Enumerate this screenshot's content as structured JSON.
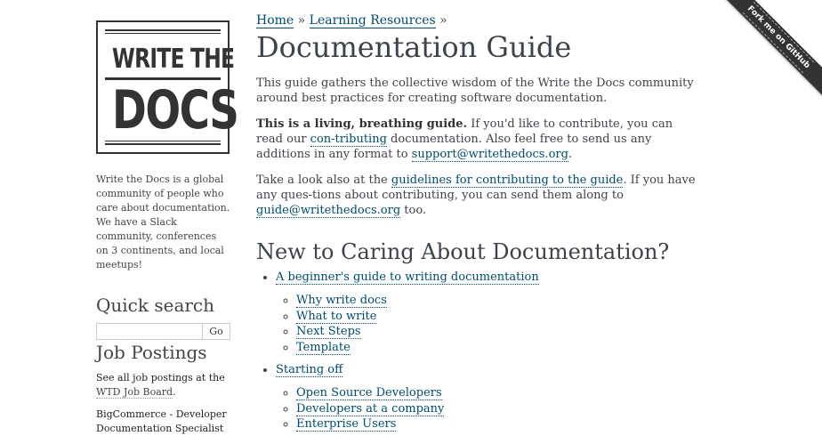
{
  "sidebar": {
    "logo": {
      "line1": "WRITE THE",
      "line2": "DOCS"
    },
    "about": "Write the Docs is a global community of people who care about documentation. We have a Slack community, conferences on 3 continents, and local meetups!",
    "quick_search": {
      "heading": "Quick search",
      "input_value": "",
      "button": "Go"
    },
    "job_postings": {
      "heading": "Job Postings",
      "see_all_prefix": "See all job postings at the ",
      "board_link": "WTD Job Board",
      "see_all_suffix": ".",
      "first_job": "BigCommerce - Developer Documentation Specialist"
    }
  },
  "main": {
    "breadcrumbs": [
      {
        "label": "Home"
      },
      {
        "label": "Learning Resources"
      }
    ],
    "title": "Documentation Guide",
    "intro": "This guide gathers the collective wisdom of the Write the Docs community around best practices for creating software documentation.",
    "living": {
      "bold": "This is a living, breathing guide.",
      "text1": " If you'd like to contribute, you can read our ",
      "link1": "con-tributing",
      "text2": " documentation. Also feel free to send us any additions in any format to ",
      "link2": "support@writethedocs.org",
      "text3": "."
    },
    "guidelines": {
      "text1": "Take a look also at the ",
      "link1": "guidelines for contributing to the guide",
      "text2": ". If you have any ques-tions about contributing, you can send them along to ",
      "link2": "guide@writethedocs.org",
      "text3": " too."
    },
    "section_heading": "New to Caring About Documentation?",
    "list": [
      {
        "label": "A beginner's guide to writing documentation",
        "children": [
          "Why write docs",
          "What to write",
          "Next Steps",
          "Template"
        ]
      },
      {
        "label": "Starting off",
        "children": [
          "Open Source Developers",
          "Developers at a company",
          "Enterprise Users"
        ]
      }
    ]
  },
  "ribbon": {
    "label": "Fork me on GitHub"
  }
}
